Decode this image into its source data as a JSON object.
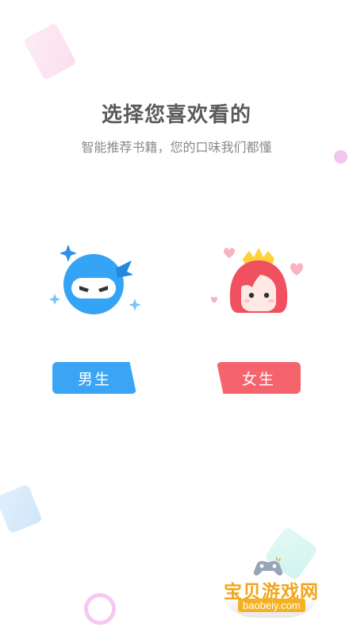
{
  "header": {
    "title": "选择您喜欢看的",
    "subtitle": "智能推荐书籍，您的口味我们都懂"
  },
  "options": {
    "male": {
      "label": "男生",
      "color": "#3aa5f5",
      "icon": "ninja-boy-icon"
    },
    "female": {
      "label": "女生",
      "color": "#f5646d",
      "icon": "princess-girl-icon"
    }
  },
  "watermark": {
    "title": "宝贝游戏网",
    "domain": "baobeiy.com"
  }
}
